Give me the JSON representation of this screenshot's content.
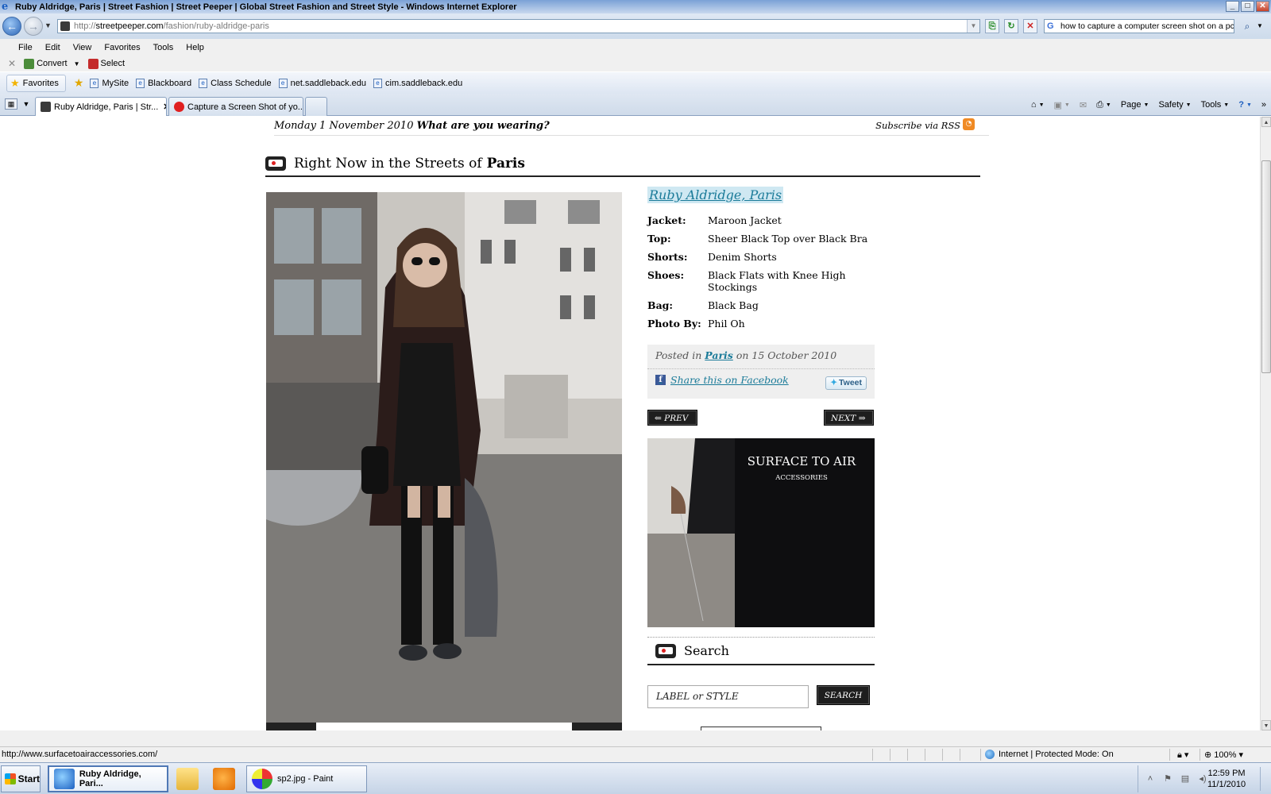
{
  "window": {
    "title": "Ruby Aldridge, Paris | Street Fashion | Street Peeper | Global Street Fashion and Street Style - Windows Internet Explorer",
    "controls": [
      "_",
      "□",
      "✕"
    ]
  },
  "address": {
    "url_prefix": "http://",
    "url_host": "streetpeeper.com",
    "url_path": "/fashion/ruby-aldridge-paris",
    "search_value": "how to capture a computer screen shot on a pc"
  },
  "menu": [
    "File",
    "Edit",
    "View",
    "Favorites",
    "Tools",
    "Help"
  ],
  "convert_toolbar": {
    "convert": "Convert",
    "select": "Select"
  },
  "favorites_bar": {
    "favorites_label": "Favorites",
    "links": [
      "MySite",
      "Blackboard",
      "Class Schedule",
      "net.saddleback.edu",
      "cim.saddleback.edu"
    ]
  },
  "tabs": [
    {
      "label": "Ruby Aldridge, Paris | Str...",
      "active": true,
      "icon_color": "#3a3a3a"
    },
    {
      "label": "Capture a Screen Shot of yo...",
      "active": false,
      "icon_color": "#e02020"
    }
  ],
  "command_bar": {
    "page": "Page",
    "safety": "Safety",
    "tools": "Tools"
  },
  "page": {
    "date": "Monday 1 November 2010",
    "question": "What are you wearing?",
    "subscribe": "Subscribe via RSS",
    "section_prefix": "Right Now in the Streets of",
    "section_city": "Paris",
    "look": {
      "title": "Ruby Aldridge, Paris",
      "rows": [
        {
          "label": "Jacket:",
          "value": "Maroon Jacket"
        },
        {
          "label": "Top:",
          "value": "Sheer Black Top over Black Bra"
        },
        {
          "label": "Shorts:",
          "value": "Denim Shorts"
        },
        {
          "label": "Shoes:",
          "value": "Black Flats with Knee High Stockings"
        },
        {
          "label": "Bag:",
          "value": "Black Bag"
        },
        {
          "label": "Photo By:",
          "value": "Phil Oh"
        }
      ]
    },
    "posted": {
      "prefix": "Posted in",
      "city": "Paris",
      "on_date": "on 15 October 2010"
    },
    "share_facebook": "Share this on Facebook",
    "tweet": "Tweet",
    "prev": "PREV",
    "next": "NEXT",
    "ad": {
      "brand": "SURFACE TO AIR",
      "tagline": "ACCESSORIES"
    },
    "search_title": "Search",
    "search_placeholder": "LABEL or STYLE",
    "search_button": "SEARCH"
  },
  "statusbar": {
    "url": "http://www.surfacetoairaccessories.com/",
    "zone": "Internet | Protected Mode: On",
    "zoom": "100%"
  },
  "taskbar": {
    "start": "Start",
    "ie_window": "Ruby Aldridge, Pari...",
    "paint_window": "sp2.jpg - Paint",
    "time": "12:59 PM",
    "date": "11/1/2010"
  },
  "colors": {
    "link_teal": "#1b7b99",
    "title_highlight": "#cfe8f2",
    "dark_button": "#1e1e1e"
  }
}
